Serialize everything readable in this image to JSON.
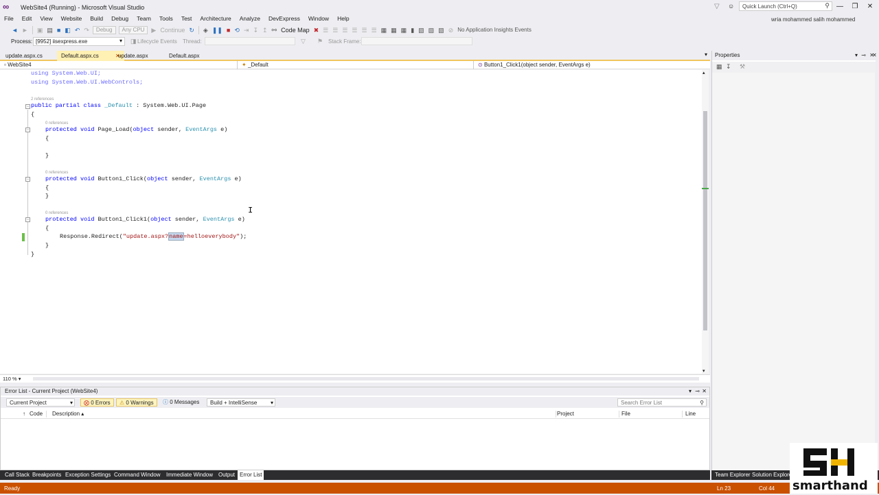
{
  "window": {
    "title": "WebSite4 (Running) - Microsoft Visual Studio",
    "user": "wria mohammed salih mohammed"
  },
  "quick_launch": {
    "placeholder": "Quick Launch (Ctrl+Q)"
  },
  "menu": [
    "File",
    "Edit",
    "View",
    "Website",
    "Build",
    "Debug",
    "Team",
    "Tools",
    "Test",
    "Architecture",
    "Analyze",
    "DevExpress",
    "Window",
    "Help"
  ],
  "toolbar": {
    "config": "Debug",
    "platform": "Any CPU",
    "continue": "Continue",
    "code_map": "Code Map",
    "insights": "No Application Insights Events"
  },
  "toolbar2": {
    "process_label": "Process:",
    "process_value": "[9952] iisexpress.exe",
    "lifecycle": "Lifecycle Events",
    "thread": "Thread:",
    "stack": "Stack Frame:"
  },
  "tabs": [
    {
      "label": "update.aspx.cs"
    },
    {
      "label": "Default.aspx.cs"
    },
    {
      "label": "update.aspx"
    },
    {
      "label": "Default.aspx"
    }
  ],
  "nav": {
    "project": "WebSite4",
    "class": "_Default",
    "member": "Button1_Click1(object sender, EventArgs e)"
  },
  "code": {
    "l1": "using System.Web.UI;",
    "l2": "using System.Web.UI.WebControls;",
    "refs2": "2 references",
    "class_kw": "public partial class",
    "class_name": "_Default",
    "class_base": ": System.Web.UI.Page",
    "open": "{",
    "close": "}",
    "refs0": "0 references",
    "protected": "protected",
    "void": "void",
    "m1": "Page_Load(",
    "m2": "Button1_Click(",
    "m3": "Button1_Click1(",
    "object": "object",
    "sender": "sender,",
    "eventargs": "EventArgs",
    "e": "e)",
    "redirect": "Response.Redirect(",
    "str1": "\"update.aspx?",
    "str_sel": "name",
    "str2": "=helloeverybody\"",
    "end": ");"
  },
  "zoom": "110 %",
  "error_list": {
    "title": "Error List - Current Project (WebSite4)",
    "scope": "Current Project",
    "errors": "0 Errors",
    "warnings": "0 Warnings",
    "messages": "0 Messages",
    "build": "Build + IntelliSense",
    "search": "Search Error List",
    "cols": {
      "code": "Code",
      "description": "Description",
      "project": "Project",
      "file": "File",
      "line": "Line"
    }
  },
  "bottom_tabs": [
    "Call Stack",
    "Breakpoints",
    "Exception Settings",
    "Command Window",
    "Immediate Window",
    "Output",
    "Error List"
  ],
  "right_tabs": [
    "Team Explorer",
    "Solution Explorer"
  ],
  "properties": {
    "title": "Properties"
  },
  "status": {
    "ready": "Ready",
    "ln": "Ln 23",
    "col": "Col 44"
  },
  "logo": {
    "brand": "smarthand",
    "mark": "SH"
  },
  "colors": {
    "status_bar": "#ca5100",
    "active_tab": "#fff0b3",
    "keyword": "#0000ff",
    "type": "#2b91af",
    "string": "#a31515"
  }
}
